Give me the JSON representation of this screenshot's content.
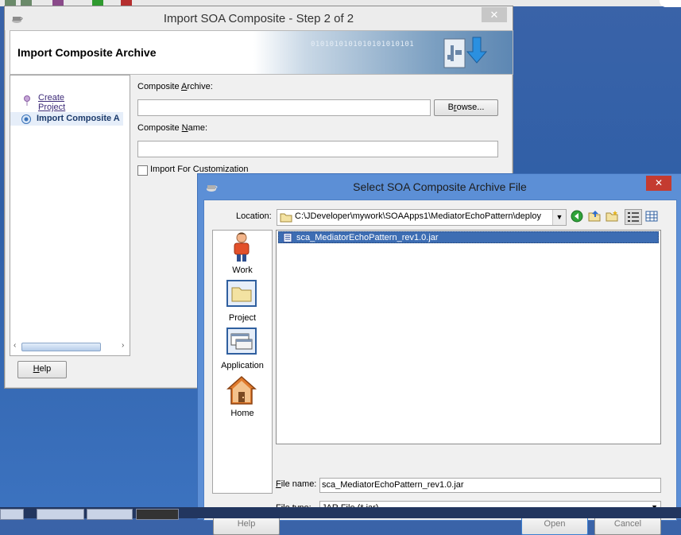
{
  "import_wizard": {
    "title": "Import SOA Composite - Step 2 of 2",
    "close_label": "✕",
    "header": "Import Composite Archive",
    "banner_binary": "0101010101010101010101",
    "steps": [
      "Create Project",
      "Import Composite A"
    ],
    "composite_archive_label_pre": "Composite ",
    "composite_archive_label_key": "A",
    "composite_archive_label_post": "rchive:",
    "composite_archive_value": "",
    "browse_pre": "B",
    "browse_key": "r",
    "browse_post": "owse...",
    "composite_name_label_pre": "Composite ",
    "composite_name_label_key": "N",
    "composite_name_label_post": "ame:",
    "composite_name_value": "",
    "customization_label": "Import For Customization",
    "help_key": "H",
    "help_post": "elp"
  },
  "file_dialog": {
    "title": "Select SOA Composite Archive File",
    "close_label": "✕",
    "location_label": "Location:",
    "location_value": "C:\\JDeveloper\\mywork\\SOAApps1\\MediatorEchoPattern\\deploy",
    "places": [
      "Work",
      "Project",
      "Application",
      "Home"
    ],
    "files": [
      "sca_MediatorEchoPattern_rev1.0.jar"
    ],
    "file_name_label_key": "F",
    "file_name_label_post": "ile name:",
    "file_name_value": "sca_MediatorEchoPattern_rev1.0.jar",
    "file_type_label_pre": "File ",
    "file_type_label_key": "t",
    "file_type_label_post": "ype:",
    "file_type_value": "JAR File (*.jar)",
    "help_label": "Help",
    "open_label": "Open",
    "cancel_label": "Cancel"
  },
  "colors": {
    "selection": "#3d6db3",
    "dialog_frame": "#5c8fd6",
    "close_red": "#c43b30"
  }
}
